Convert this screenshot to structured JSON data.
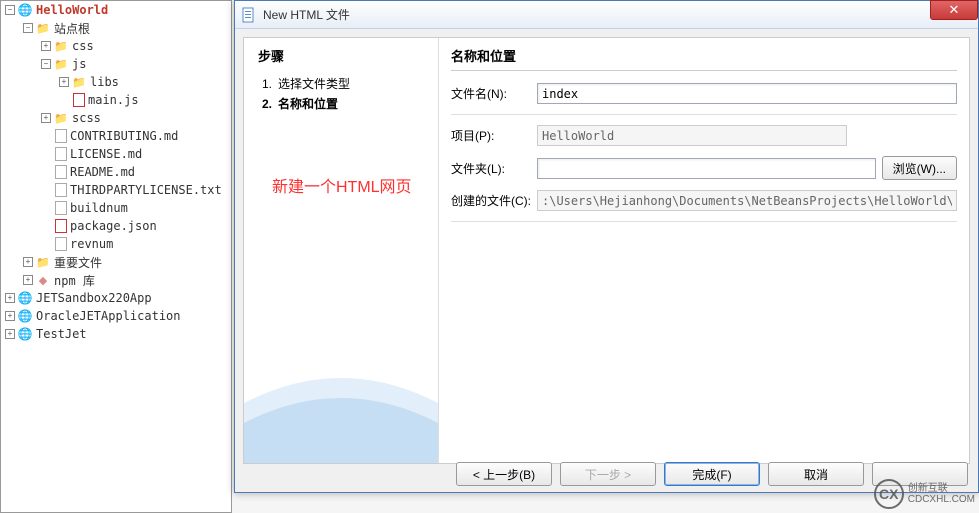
{
  "tree": {
    "root": "HelloWorld",
    "siteRoot": "站点根",
    "css": "css",
    "js": "js",
    "libs": "libs",
    "mainjs": "main.js",
    "scss": "scss",
    "contributing": "CONTRIBUTING.md",
    "license": "LICENSE.md",
    "readme": "README.md",
    "thirdparty": "THIRDPARTYLICENSE.txt",
    "buildnum": "buildnum",
    "package": "package.json",
    "revnum": "revnum",
    "importantFiles": "重要文件",
    "npm": "npm 库",
    "jetSandbox": "JETSandbox220App",
    "oracleJet": "OracleJETApplication",
    "testJet": "TestJet"
  },
  "dialog": {
    "title": "New HTML 文件",
    "leftHeading": "步骤",
    "step1": "选择文件类型",
    "step2": "名称和位置",
    "annotation": "新建一个HTML网页",
    "rightHeading": "名称和位置",
    "labels": {
      "filename": "文件名(N):",
      "project": "项目(P):",
      "folder": "文件夹(L):",
      "created": "创建的文件(C):"
    },
    "values": {
      "filename": "index",
      "project": "HelloWorld",
      "folder": "",
      "created": ":\\Users\\Hejianhong\\Documents\\NetBeansProjects\\HelloWorld\\index.html"
    },
    "buttons": {
      "browse": "浏览(W)...",
      "back": "< 上一步(B)",
      "next": "下一步 >",
      "finish": "完成(F)",
      "cancel": "取消"
    }
  },
  "watermark": {
    "logo": "CX",
    "line1": "创新互联",
    "line2": "CDCXHL.COM"
  }
}
